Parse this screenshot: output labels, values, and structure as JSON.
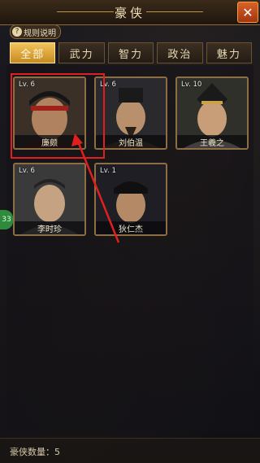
{
  "header": {
    "title": "豪侠",
    "close_icon": "close-icon"
  },
  "rules_button": {
    "label": "规则说明",
    "icon": "?"
  },
  "tabs": [
    {
      "label": "全部",
      "active": true
    },
    {
      "label": "武力",
      "active": false
    },
    {
      "label": "智力",
      "active": false
    },
    {
      "label": "政治",
      "active": false
    },
    {
      "label": "魅力",
      "active": false
    }
  ],
  "heroes": [
    {
      "level": "Lv. 6",
      "name": "廉颇"
    },
    {
      "level": "Lv. 6",
      "name": "刘伯温"
    },
    {
      "level": "Lv. 10",
      "name": "王羲之"
    },
    {
      "level": "Lv. 6",
      "name": "李时珍"
    },
    {
      "level": "Lv. 1",
      "name": "狄仁杰"
    }
  ],
  "side_badge": "33",
  "footer": {
    "count_label": "豪侠数量：",
    "count_value": "5"
  },
  "colors": {
    "accent": "#f2c45b",
    "highlight": "#e0201e",
    "close": "#d9622a"
  }
}
